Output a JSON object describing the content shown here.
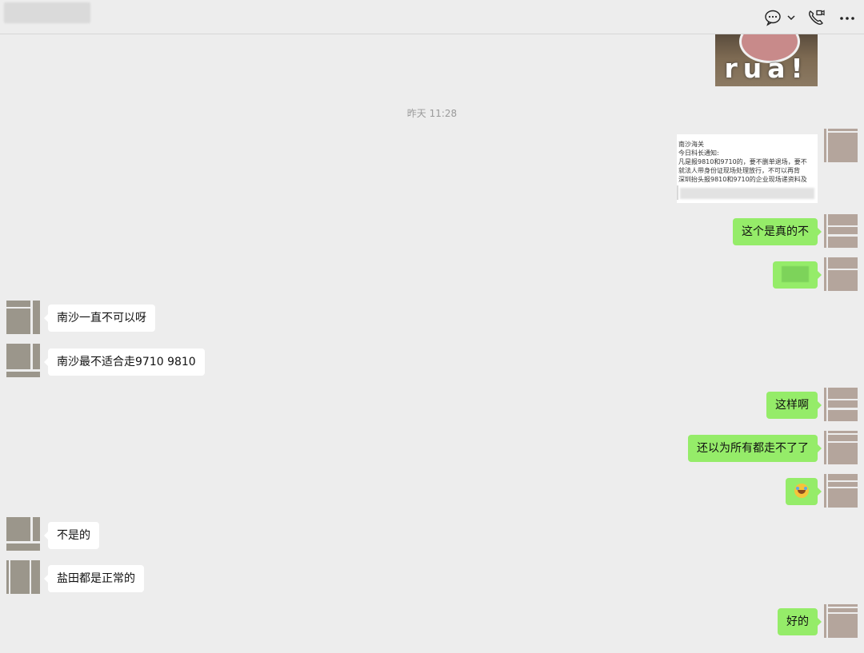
{
  "header": {
    "icons": [
      "chat-bubble-icon",
      "chevron-down-icon",
      "video-call-icon",
      "more-icon"
    ]
  },
  "sticker": {
    "text": "rua!"
  },
  "timestamp": "昨天 11:28",
  "doc_card": {
    "lines": [
      "南沙海关",
      "今日科长通知:",
      "凡是报9810和9710的，要不删单退场，要不",
      "就法人带身份证现场处理放行，不可以再背",
      "深圳抬头报9810和9710的企业现场递资料及"
    ]
  },
  "messages": [
    {
      "side": "self",
      "text": "这个是真的不"
    },
    {
      "side": "self",
      "text": ""
    },
    {
      "side": "other",
      "text": "南沙一直不可以呀"
    },
    {
      "side": "other",
      "text": "南沙最不适合走9710 9810"
    },
    {
      "side": "self",
      "text": "这样啊"
    },
    {
      "side": "self",
      "text": "还以为所有都走不了了"
    },
    {
      "side": "self",
      "text": ""
    },
    {
      "side": "other",
      "text": "不是的"
    },
    {
      "side": "other",
      "text": "盐田都是正常的"
    },
    {
      "side": "self",
      "text": "好的"
    }
  ],
  "colors": {
    "background": "#ededed",
    "self_bubble": "#95ec69",
    "other_bubble": "#ffffff",
    "timestamp": "#9a9a9a"
  }
}
